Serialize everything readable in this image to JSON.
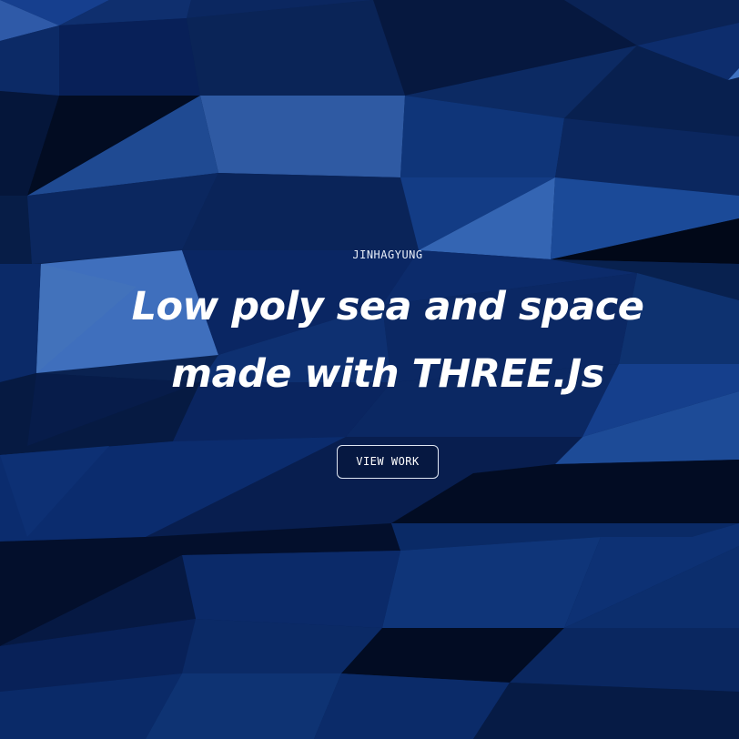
{
  "hero": {
    "eyebrow": "JINHAGYUNG",
    "headline_line1": "Low poly sea and space",
    "headline_line2": "made with THREE.Js",
    "cta_label": "VIEW WORK"
  },
  "theme": {
    "background": "#0a2251",
    "accent_light": "#3f72c0",
    "accent_dark": "#020c1f",
    "text": "#ffffff"
  }
}
